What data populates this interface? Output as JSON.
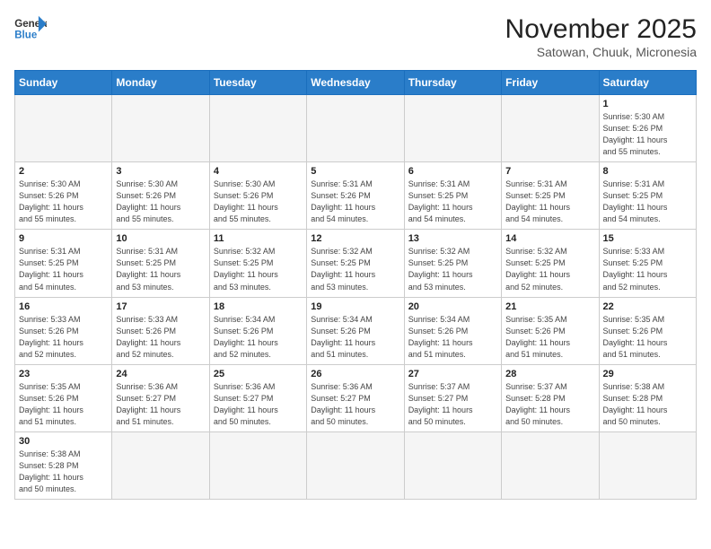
{
  "header": {
    "logo_general": "General",
    "logo_blue": "Blue",
    "main_title": "November 2025",
    "subtitle": "Satowan, Chuuk, Micronesia"
  },
  "weekdays": [
    "Sunday",
    "Monday",
    "Tuesday",
    "Wednesday",
    "Thursday",
    "Friday",
    "Saturday"
  ],
  "weeks": [
    [
      {
        "day": "",
        "info": ""
      },
      {
        "day": "",
        "info": ""
      },
      {
        "day": "",
        "info": ""
      },
      {
        "day": "",
        "info": ""
      },
      {
        "day": "",
        "info": ""
      },
      {
        "day": "",
        "info": ""
      },
      {
        "day": "1",
        "info": "Sunrise: 5:30 AM\nSunset: 5:26 PM\nDaylight: 11 hours\nand 55 minutes."
      }
    ],
    [
      {
        "day": "2",
        "info": "Sunrise: 5:30 AM\nSunset: 5:26 PM\nDaylight: 11 hours\nand 55 minutes."
      },
      {
        "day": "3",
        "info": "Sunrise: 5:30 AM\nSunset: 5:26 PM\nDaylight: 11 hours\nand 55 minutes."
      },
      {
        "day": "4",
        "info": "Sunrise: 5:30 AM\nSunset: 5:26 PM\nDaylight: 11 hours\nand 55 minutes."
      },
      {
        "day": "5",
        "info": "Sunrise: 5:31 AM\nSunset: 5:26 PM\nDaylight: 11 hours\nand 54 minutes."
      },
      {
        "day": "6",
        "info": "Sunrise: 5:31 AM\nSunset: 5:25 PM\nDaylight: 11 hours\nand 54 minutes."
      },
      {
        "day": "7",
        "info": "Sunrise: 5:31 AM\nSunset: 5:25 PM\nDaylight: 11 hours\nand 54 minutes."
      },
      {
        "day": "8",
        "info": "Sunrise: 5:31 AM\nSunset: 5:25 PM\nDaylight: 11 hours\nand 54 minutes."
      }
    ],
    [
      {
        "day": "9",
        "info": "Sunrise: 5:31 AM\nSunset: 5:25 PM\nDaylight: 11 hours\nand 54 minutes."
      },
      {
        "day": "10",
        "info": "Sunrise: 5:31 AM\nSunset: 5:25 PM\nDaylight: 11 hours\nand 53 minutes."
      },
      {
        "day": "11",
        "info": "Sunrise: 5:32 AM\nSunset: 5:25 PM\nDaylight: 11 hours\nand 53 minutes."
      },
      {
        "day": "12",
        "info": "Sunrise: 5:32 AM\nSunset: 5:25 PM\nDaylight: 11 hours\nand 53 minutes."
      },
      {
        "day": "13",
        "info": "Sunrise: 5:32 AM\nSunset: 5:25 PM\nDaylight: 11 hours\nand 53 minutes."
      },
      {
        "day": "14",
        "info": "Sunrise: 5:32 AM\nSunset: 5:25 PM\nDaylight: 11 hours\nand 52 minutes."
      },
      {
        "day": "15",
        "info": "Sunrise: 5:33 AM\nSunset: 5:25 PM\nDaylight: 11 hours\nand 52 minutes."
      }
    ],
    [
      {
        "day": "16",
        "info": "Sunrise: 5:33 AM\nSunset: 5:26 PM\nDaylight: 11 hours\nand 52 minutes."
      },
      {
        "day": "17",
        "info": "Sunrise: 5:33 AM\nSunset: 5:26 PM\nDaylight: 11 hours\nand 52 minutes."
      },
      {
        "day": "18",
        "info": "Sunrise: 5:34 AM\nSunset: 5:26 PM\nDaylight: 11 hours\nand 52 minutes."
      },
      {
        "day": "19",
        "info": "Sunrise: 5:34 AM\nSunset: 5:26 PM\nDaylight: 11 hours\nand 51 minutes."
      },
      {
        "day": "20",
        "info": "Sunrise: 5:34 AM\nSunset: 5:26 PM\nDaylight: 11 hours\nand 51 minutes."
      },
      {
        "day": "21",
        "info": "Sunrise: 5:35 AM\nSunset: 5:26 PM\nDaylight: 11 hours\nand 51 minutes."
      },
      {
        "day": "22",
        "info": "Sunrise: 5:35 AM\nSunset: 5:26 PM\nDaylight: 11 hours\nand 51 minutes."
      }
    ],
    [
      {
        "day": "23",
        "info": "Sunrise: 5:35 AM\nSunset: 5:26 PM\nDaylight: 11 hours\nand 51 minutes."
      },
      {
        "day": "24",
        "info": "Sunrise: 5:36 AM\nSunset: 5:27 PM\nDaylight: 11 hours\nand 51 minutes."
      },
      {
        "day": "25",
        "info": "Sunrise: 5:36 AM\nSunset: 5:27 PM\nDaylight: 11 hours\nand 50 minutes."
      },
      {
        "day": "26",
        "info": "Sunrise: 5:36 AM\nSunset: 5:27 PM\nDaylight: 11 hours\nand 50 minutes."
      },
      {
        "day": "27",
        "info": "Sunrise: 5:37 AM\nSunset: 5:27 PM\nDaylight: 11 hours\nand 50 minutes."
      },
      {
        "day": "28",
        "info": "Sunrise: 5:37 AM\nSunset: 5:28 PM\nDaylight: 11 hours\nand 50 minutes."
      },
      {
        "day": "29",
        "info": "Sunrise: 5:38 AM\nSunset: 5:28 PM\nDaylight: 11 hours\nand 50 minutes."
      }
    ],
    [
      {
        "day": "30",
        "info": "Sunrise: 5:38 AM\nSunset: 5:28 PM\nDaylight: 11 hours\nand 50 minutes."
      },
      {
        "day": "",
        "info": ""
      },
      {
        "day": "",
        "info": ""
      },
      {
        "day": "",
        "info": ""
      },
      {
        "day": "",
        "info": ""
      },
      {
        "day": "",
        "info": ""
      },
      {
        "day": "",
        "info": ""
      }
    ]
  ]
}
